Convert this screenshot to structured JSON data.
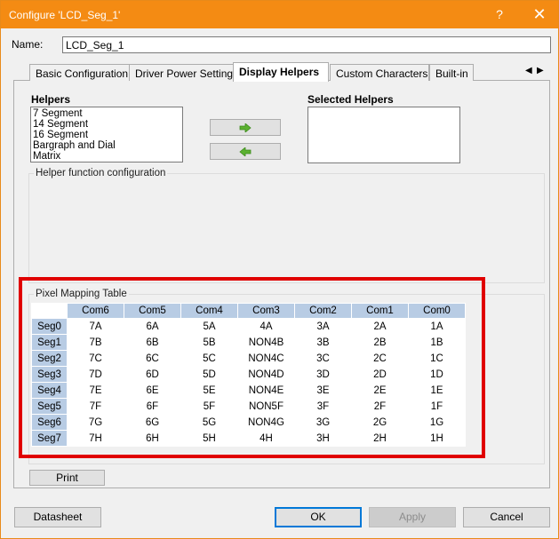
{
  "window": {
    "title": "Configure 'LCD_Seg_1'",
    "help": "?",
    "close": "✕"
  },
  "name": {
    "label": "Name:",
    "value": "LCD_Seg_1"
  },
  "tabs": [
    {
      "label": "Basic Configuration"
    },
    {
      "label": "Driver Power Settings"
    },
    {
      "label": "Display Helpers"
    },
    {
      "label": "Custom Characters"
    },
    {
      "label": "Built-in"
    }
  ],
  "tab_scroll": {
    "left": "◀",
    "right": "▶"
  },
  "helpers": {
    "title": "Helpers",
    "items": [
      "7 Segment",
      "14 Segment",
      "16 Segment",
      "Bargraph and Dial",
      "Matrix"
    ],
    "selected_title": "Selected Helpers",
    "add_icon": "right-arrow-icon",
    "remove_icon": "left-arrow-icon"
  },
  "helper_config": {
    "title": "Helper function configuration"
  },
  "pixel_mapping": {
    "title": "Pixel Mapping Table",
    "columns": [
      "Com6",
      "Com5",
      "Com4",
      "Com3",
      "Com2",
      "Com1",
      "Com0"
    ],
    "rows": [
      {
        "seg": "Seg0",
        "cells": [
          "7A",
          "6A",
          "5A",
          "4A",
          "3A",
          "2A",
          "1A"
        ]
      },
      {
        "seg": "Seg1",
        "cells": [
          "7B",
          "6B",
          "5B",
          "NON4B",
          "3B",
          "2B",
          "1B"
        ]
      },
      {
        "seg": "Seg2",
        "cells": [
          "7C",
          "6C",
          "5C",
          "NON4C",
          "3C",
          "2C",
          "1C"
        ]
      },
      {
        "seg": "Seg3",
        "cells": [
          "7D",
          "6D",
          "5D",
          "NON4D",
          "3D",
          "2D",
          "1D"
        ]
      },
      {
        "seg": "Seg4",
        "cells": [
          "7E",
          "6E",
          "5E",
          "NON4E",
          "3E",
          "2E",
          "1E"
        ]
      },
      {
        "seg": "Seg5",
        "cells": [
          "7F",
          "6F",
          "5F",
          "NON5F",
          "3F",
          "2F",
          "1F"
        ]
      },
      {
        "seg": "Seg6",
        "cells": [
          "7G",
          "6G",
          "5G",
          "NON4G",
          "3G",
          "2G",
          "1G"
        ]
      },
      {
        "seg": "Seg7",
        "cells": [
          "7H",
          "6H",
          "5H",
          "4H",
          "3H",
          "2H",
          "1H"
        ]
      }
    ]
  },
  "print_label": "Print",
  "buttons": {
    "datasheet": "Datasheet",
    "ok": "OK",
    "apply": "Apply",
    "cancel": "Cancel"
  },
  "colors": {
    "titlebar": "#f48b13",
    "header_cell": "#b8cce4",
    "highlight": "#e00000",
    "arrow": "#5bb130"
  }
}
